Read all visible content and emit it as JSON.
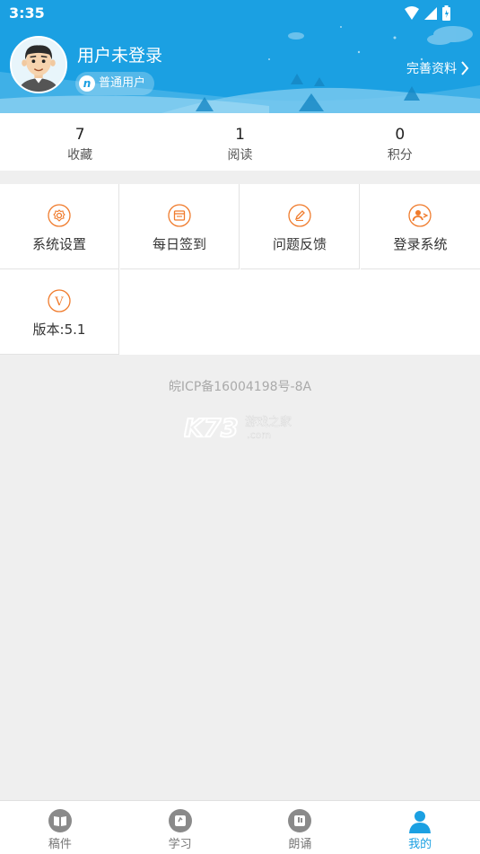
{
  "status_bar": {
    "time": "3:35"
  },
  "profile": {
    "username": "用户未登录",
    "badge_icon_letter": "n",
    "badge_label": "普通用户",
    "complete_profile_label": "完善资料"
  },
  "stats": [
    {
      "value": "7",
      "label": "收藏"
    },
    {
      "value": "1",
      "label": "阅读"
    },
    {
      "value": "0",
      "label": "积分"
    }
  ],
  "grid": [
    {
      "label": "系统设置",
      "icon": "gear-icon"
    },
    {
      "label": "每日签到",
      "icon": "calendar-icon"
    },
    {
      "label": "问题反馈",
      "icon": "pencil-icon"
    },
    {
      "label": "登录系统",
      "icon": "user-login-icon"
    },
    {
      "label": "版本:5.1",
      "icon": "version-icon",
      "icon_letter": "V"
    }
  ],
  "footer": {
    "icp": "皖ICP备16004198号-8A",
    "watermark_text": "K73",
    "watermark_sub": "游戏之家",
    "watermark_domain": ".com"
  },
  "bottom_nav": [
    {
      "label": "稿件",
      "icon": "book-icon",
      "active": false
    },
    {
      "label": "学习",
      "icon": "study-icon",
      "active": false
    },
    {
      "label": "朗诵",
      "icon": "recite-icon",
      "active": false
    },
    {
      "label": "我的",
      "icon": "person-icon",
      "active": true
    }
  ],
  "colors": {
    "header_blue": "#1ba0e2",
    "accent_orange": "#f07b2c",
    "nav_inactive": "#8a8a8a",
    "nav_active": "#1ba0e2"
  }
}
